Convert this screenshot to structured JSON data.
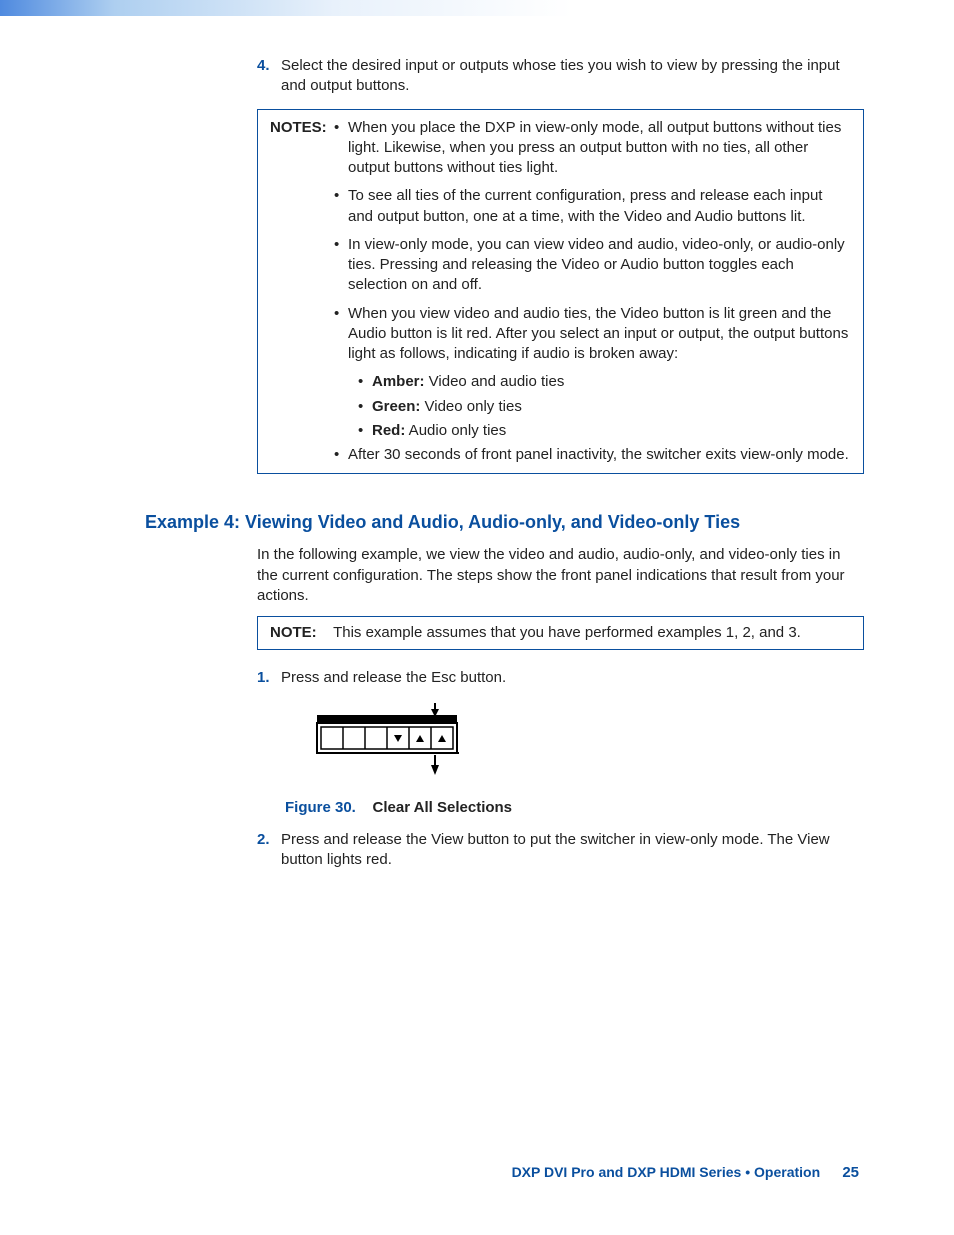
{
  "step4": {
    "num": "4.",
    "text": "Select the desired input or outputs whose ties you wish to view by pressing the input and output buttons."
  },
  "notes": {
    "label": "NOTES:",
    "items": [
      "When you place the DXP in view-only mode, all output buttons without ties light. Likewise, when you press an output button with no ties, all other output buttons without ties light.",
      "To see all ties of the current configuration, press and release each input and output button, one at a time, with the Video and Audio buttons lit.",
      "In view-only mode, you can view video and audio, video-only, or audio-only ties. Pressing and releasing the Video or Audio button toggles each selection on and off.",
      "When you view video and audio ties, the Video button is lit green and the Audio button is lit red. After you select an input or output, the output buttons light as follows, indicating if audio is broken away:"
    ],
    "colors": [
      {
        "label": "Amber:",
        "desc": " Video and audio ties"
      },
      {
        "label": "Green:",
        "desc": " Video only ties"
      },
      {
        "label": "Red:",
        "desc": " Audio only ties"
      }
    ],
    "tail": "After 30 seconds of front panel inactivity, the switcher exits view-only mode."
  },
  "section": {
    "title": "Example 4: Viewing Video and Audio, Audio-only, and Video-only Ties",
    "intro": "In the following example, we view the video and audio, audio-only, and video-only ties in the current configuration. The steps show the front panel indications that result from your actions."
  },
  "note_single": {
    "label": "NOTE:",
    "text": "This example assumes that you have performed examples 1, 2, and 3."
  },
  "step1": {
    "num": "1.",
    "text": "Press and release the Esc button."
  },
  "figure": {
    "label": "Figure 30.",
    "title": "Clear All Selections"
  },
  "step2": {
    "num": "2.",
    "text": "Press and release the View button to put the switcher in view-only mode. The View button lights red."
  },
  "footer": {
    "text": "DXP DVI Pro and DXP HDMI Series • Operation",
    "page": "25"
  }
}
